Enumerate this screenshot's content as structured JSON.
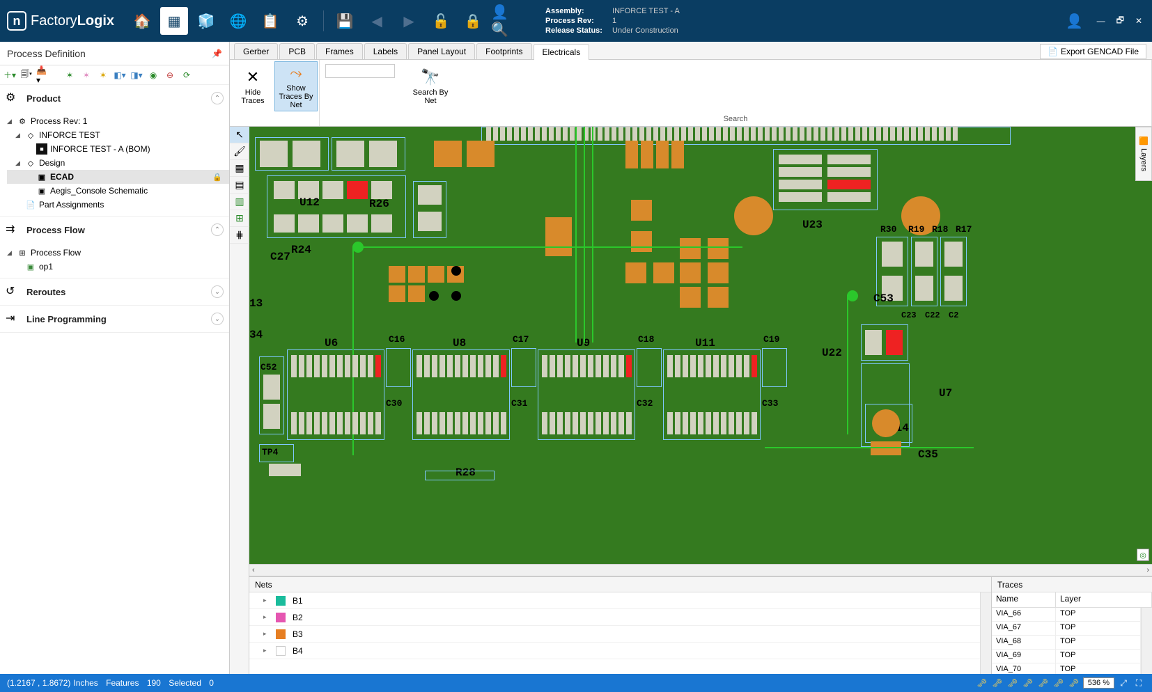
{
  "app": {
    "logo_text_a": "Factory",
    "logo_text_b": "Logix"
  },
  "header_info": {
    "assembly_label": "Assembly:",
    "assembly_value": "INFORCE TEST - A",
    "rev_label": "Process Rev:",
    "rev_value": "1",
    "status_label": "Release Status:",
    "status_value": "Under Construction"
  },
  "sidebar": {
    "title": "Process Definition",
    "sections": {
      "product": {
        "title": "Product"
      },
      "flow": {
        "title": "Process Flow"
      },
      "reroutes": {
        "title": "Reroutes"
      },
      "line": {
        "title": "Line Programming"
      }
    },
    "product_tree": {
      "rev": "Process Rev: 1",
      "asm": "INFORCE TEST",
      "bom": "INFORCE TEST - A (BOM)",
      "design": "Design",
      "ecad": "ECAD",
      "schematic": "Aegis_Console Schematic",
      "parts": "Part Assignments"
    },
    "flow_tree": {
      "root": "Process Flow",
      "op1": "op1"
    }
  },
  "tabs": {
    "t0": "Gerber",
    "t1": "PCB",
    "t2": "Frames",
    "t3": "Labels",
    "t4": "Panel Layout",
    "t5": "Footprints",
    "t6": "Electricals",
    "export": "Export GENCAD File"
  },
  "ribbon": {
    "hide": "Hide Traces",
    "show": "Show Traces By Net",
    "searchby": "Search By Net",
    "group": "Search"
  },
  "layers_tab": "Layers",
  "refs": {
    "u12": "U12",
    "r26": "R26",
    "c27": "C27",
    "r24": "R24",
    "u6": "U6",
    "u8": "U8",
    "u9": "U9",
    "u11": "U11",
    "c16": "C16",
    "c17": "C17",
    "c18": "C18",
    "c19": "C19",
    "c30": "C30",
    "c31": "C31",
    "c32": "C32",
    "c33": "C33",
    "c52": "C52",
    "tp4": "TP4",
    "r28": "R28",
    "u23": "U23",
    "r30": "R30",
    "r19": "R19",
    "r18": "R18",
    "r17": "R17",
    "c53": "C53",
    "c23": "C23",
    "c22": "C22",
    "c2": "C2",
    "u22": "U22",
    "u7": "U7",
    "j14": "J14",
    "c35": "C35",
    "b4": "34",
    "b13": "13"
  },
  "bottom": {
    "nets_title": "Nets",
    "traces_title": "Traces",
    "traces_cols": {
      "name": "Name",
      "layer": "Layer"
    },
    "nets": [
      {
        "label": "B1",
        "color": "#1abc9c"
      },
      {
        "label": "B2",
        "color": "#e556b1"
      },
      {
        "label": "B3",
        "color": "#e67e22"
      },
      {
        "label": "B4",
        "color": "#ffffff"
      }
    ],
    "traces": [
      {
        "name": "VIA_66",
        "layer": "TOP"
      },
      {
        "name": "VIA_67",
        "layer": "TOP"
      },
      {
        "name": "VIA_68",
        "layer": "TOP"
      },
      {
        "name": "VIA_69",
        "layer": "TOP"
      },
      {
        "name": "VIA_70",
        "layer": "TOP"
      }
    ]
  },
  "status": {
    "coords": "(1.2167 , 1.8672)",
    "units": "Inches",
    "features_label": "Features",
    "features_value": "190",
    "selected_label": "Selected",
    "selected_value": "0",
    "zoom": "536 %"
  }
}
